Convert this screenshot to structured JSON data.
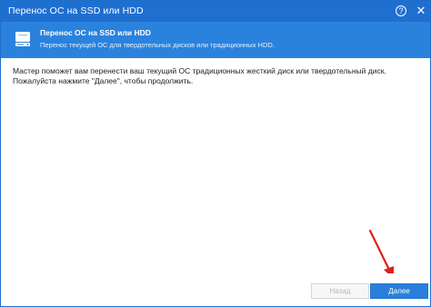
{
  "window": {
    "title": "Перенос ОС на SSD или HDD",
    "help_glyph": "?",
    "close_glyph": "✕"
  },
  "banner": {
    "icon": "drive-icon",
    "heading": "Перенос ОС на SSD или HDD",
    "subheading": "Перенос текущей ОС для твердотельных дисков или традиционных HDD."
  },
  "content": {
    "description": "Мастер поможет вам перенести ваш текущий ОС традиционных жесткий диск или твердотельный диск. Пожалуйста нажмите \"Далее\", чтобы продолжить."
  },
  "footer": {
    "back_label": "Назад",
    "next_label": "Далее"
  },
  "colors": {
    "titlebar": "#1f6fd0",
    "banner": "#2b82dd",
    "primary_button": "#2a7fdc",
    "annotation_arrow": "#e0201b"
  }
}
